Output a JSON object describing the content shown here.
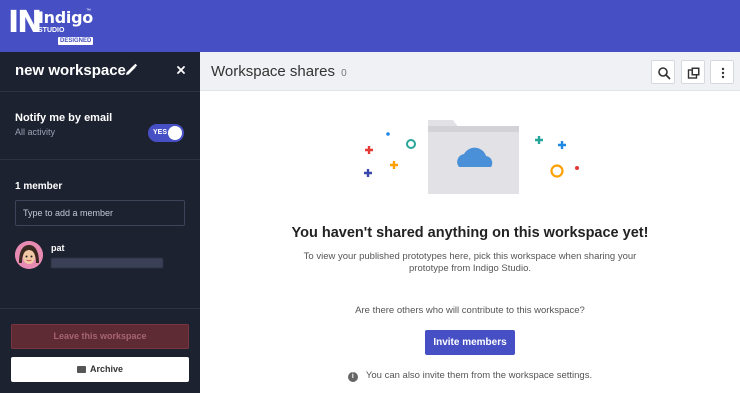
{
  "brand": {
    "logo_mark": "IN",
    "logo_word": "Indigo",
    "logo_tm": "™",
    "logo_studio": "STUDIO",
    "logo_designed": "DESIGNED"
  },
  "sidebar": {
    "workspace_name": "new workspace",
    "notify": {
      "title": "Notify me by email",
      "subtitle": "All activity",
      "toggle_label": "YES",
      "enabled": true
    },
    "members_title": "1 member",
    "member_input_placeholder": "Type to add a member",
    "members": [
      {
        "name": "pat"
      }
    ],
    "leave_label": "Leave this workspace",
    "archive_label": "Archive"
  },
  "main": {
    "title": "Workspace shares",
    "count": "0",
    "empty_title": "You haven't shared anything on this workspace yet!",
    "empty_desc": "To view your published prototypes here, pick this workspace when sharing your prototype from Indigo Studio.",
    "others_question": "Are there others who will contribute to this workspace?",
    "invite_label": "Invite members",
    "info_text": "You can also invite them from the workspace settings."
  },
  "icons": {
    "edit": "pencil-icon",
    "close": "close-icon",
    "search": "search-icon",
    "copy": "copy-icon",
    "more": "more-vertical-icon",
    "archive": "archive-icon",
    "info": "info-icon",
    "cloud": "cloud-icon"
  },
  "colors": {
    "brand": "#4650c4",
    "sidebar_bg": "#1d2231",
    "leave_bg": "#5e2b35"
  }
}
